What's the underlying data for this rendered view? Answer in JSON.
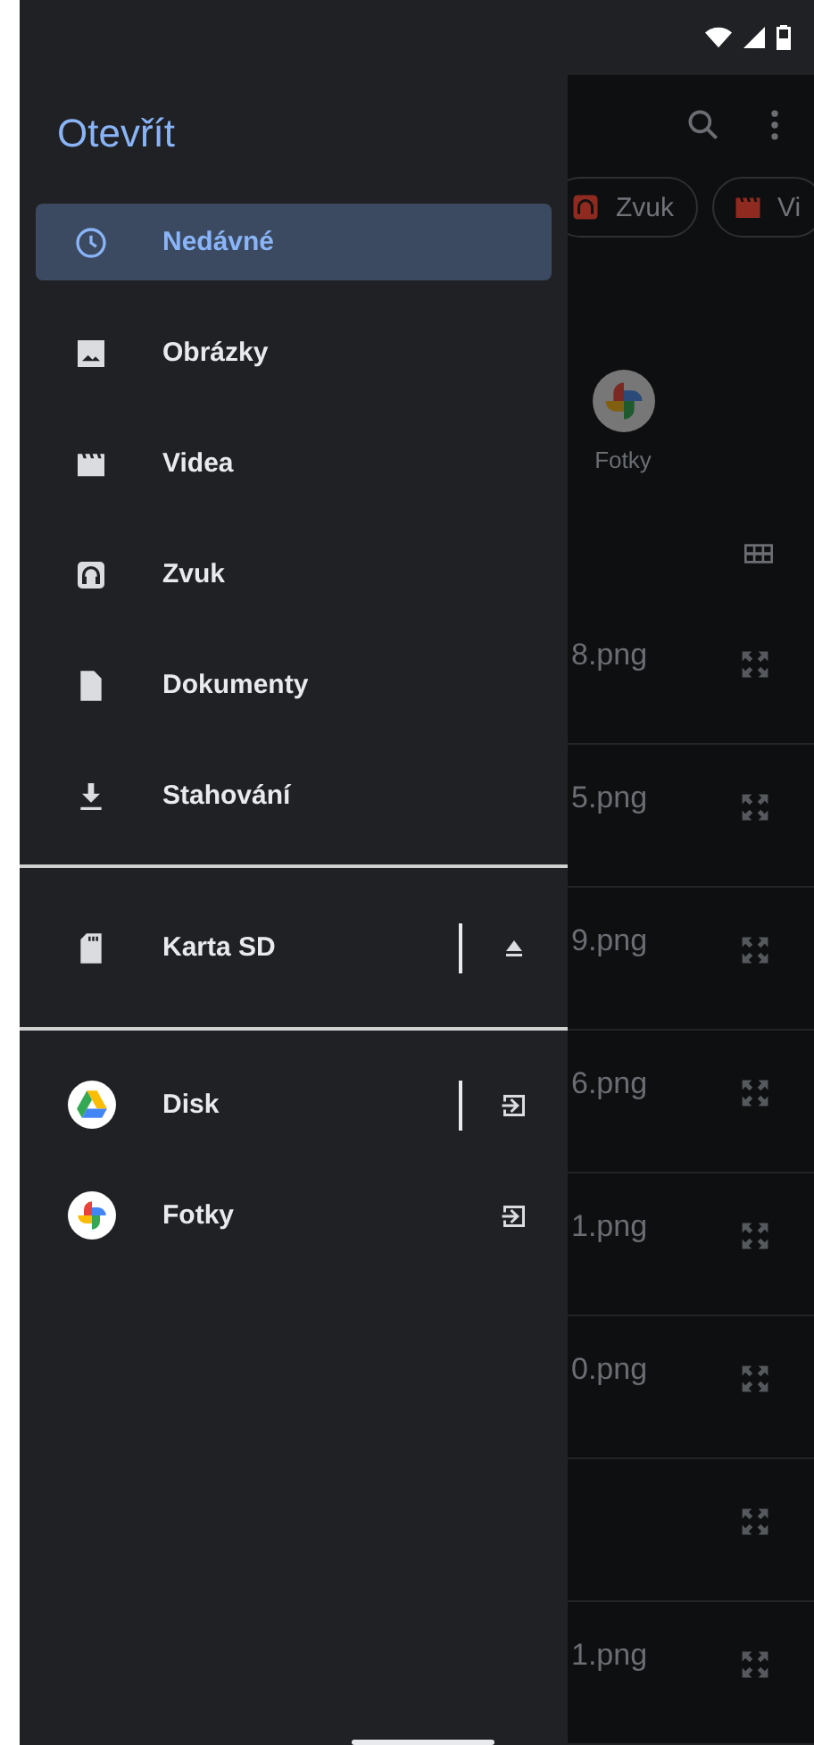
{
  "drawer": {
    "title": "Otevřít",
    "items": [
      {
        "label": "Nedávné",
        "kind": "recent",
        "selected": true
      },
      {
        "label": "Obrázky",
        "kind": "images",
        "selected": false
      },
      {
        "label": "Videa",
        "kind": "videos",
        "selected": false
      },
      {
        "label": "Zvuk",
        "kind": "audio",
        "selected": false
      },
      {
        "label": "Dokumenty",
        "kind": "documents",
        "selected": false
      },
      {
        "label": "Stahování",
        "kind": "downloads",
        "selected": false
      }
    ],
    "storage": [
      {
        "label": "Karta SD",
        "kind": "sdcard",
        "action_divider": true
      }
    ],
    "apps": [
      {
        "label": "Disk",
        "kind": "drive",
        "action_divider": true
      },
      {
        "label": "Fotky",
        "kind": "photos",
        "action_divider": false
      }
    ]
  },
  "background": {
    "chips": [
      {
        "label": "Zvuk",
        "kind": "audio"
      },
      {
        "label": "Vi",
        "kind": "videos"
      }
    ],
    "app_shortcut": {
      "label": "Fotky"
    },
    "files": [
      {
        "name": "8.png",
        "expandable": true
      },
      {
        "name": "5.png",
        "expandable": true
      },
      {
        "name": "9.png",
        "expandable": true
      },
      {
        "name": "6.png",
        "expandable": true
      },
      {
        "name": "1.png",
        "expandable": true
      },
      {
        "name": "0.png",
        "expandable": true
      },
      {
        "expandable": true
      },
      {
        "name": "1.png",
        "expandable": true
      }
    ]
  }
}
